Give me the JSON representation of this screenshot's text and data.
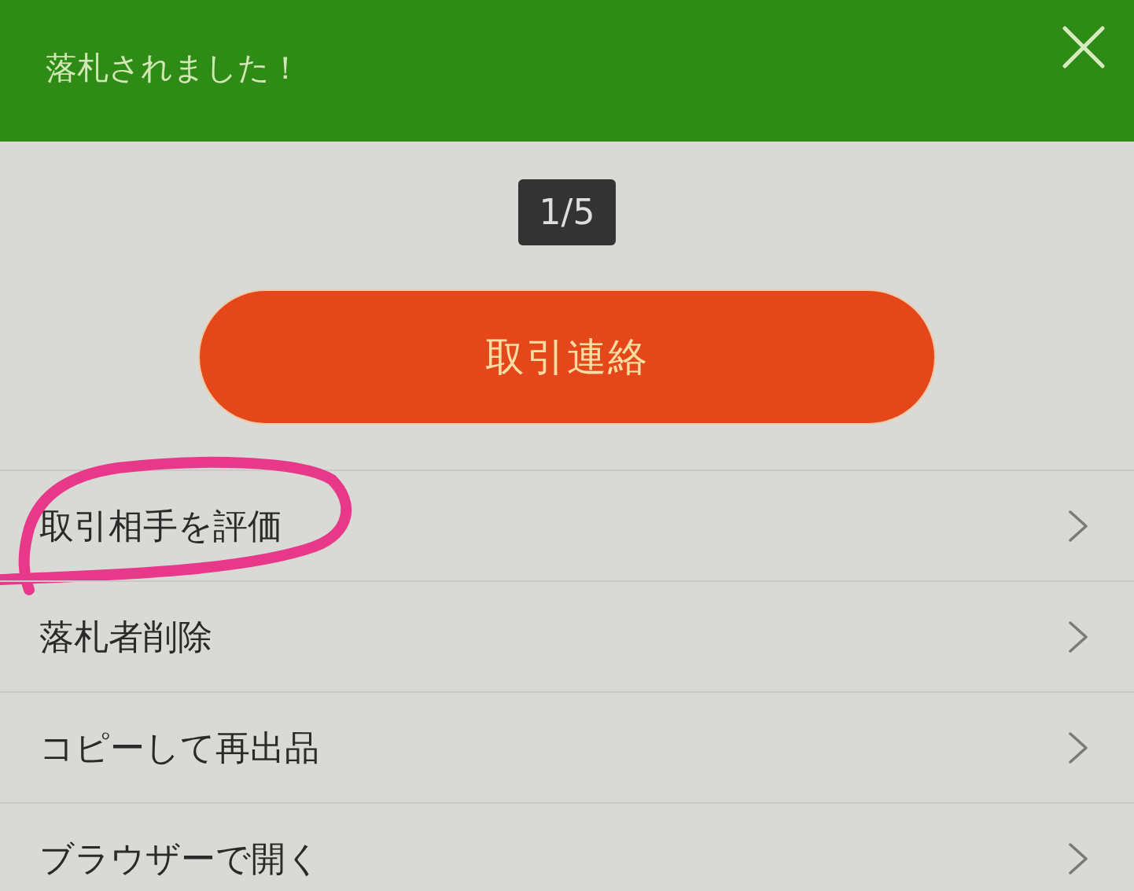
{
  "dialog": {
    "title": "落札されました！"
  },
  "pager": {
    "label": "1/5"
  },
  "primary_button": {
    "label": "取引連絡"
  },
  "menu_items": [
    {
      "label": "取引相手を評価",
      "circled": true
    },
    {
      "label": "落札者削除",
      "circled": false
    },
    {
      "label": "コピーして再出品",
      "circled": false
    },
    {
      "label": "ブラウザーで開く",
      "circled": false
    }
  ]
}
